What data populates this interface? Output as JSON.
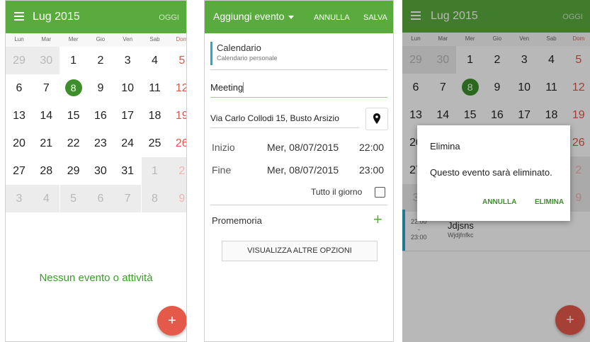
{
  "screen1": {
    "month_title": "Lug 2015",
    "today_button": "OGGI",
    "weekdays": [
      "Lun",
      "Mar",
      "Mer",
      "Gio",
      "Ven",
      "Sab",
      "Dom"
    ],
    "weeks": [
      [
        "29",
        "30",
        "1",
        "2",
        "3",
        "4",
        "5"
      ],
      [
        "6",
        "7",
        "8",
        "9",
        "10",
        "11",
        "12"
      ],
      [
        "13",
        "14",
        "15",
        "16",
        "17",
        "18",
        "19"
      ],
      [
        "20",
        "21",
        "22",
        "23",
        "24",
        "25",
        "26"
      ],
      [
        "27",
        "28",
        "29",
        "30",
        "31",
        "1",
        "2"
      ],
      [
        "3",
        "4",
        "5",
        "6",
        "7",
        "8",
        "9"
      ]
    ],
    "empty_message": "Nessun evento o attività",
    "fab_label": "+"
  },
  "screen2": {
    "header_title": "Aggiungi evento",
    "cancel_label": "ANNULLA",
    "save_label": "SALVA",
    "calendar_name": "Calendario",
    "calendar_sub": "Calendario personale",
    "title_value": "Meeting",
    "location_value": "Via Carlo Collodi 15, Busto Arsizio",
    "start_label": "Inizio",
    "start_date": "Mer, 08/07/2015",
    "start_time": "22:00",
    "end_label": "Fine",
    "end_date": "Mer, 08/07/2015",
    "end_time": "23:00",
    "all_day_label": "Tutto il giorno",
    "reminder_label": "Promemoria",
    "reminder_add": "+",
    "more_options_label": "VISUALIZZA ALTRE OPZIONI"
  },
  "screen3": {
    "month_title": "Lug 2015",
    "today_button": "OGGI",
    "event_time_start": "22:00",
    "event_time_sep": "-",
    "event_time_end": "23:00",
    "event_title": "Jdjsns",
    "event_location": "Wjdjfnfkc",
    "dialog_title": "Elimina",
    "dialog_message": "Questo evento sarà eliminato.",
    "dialog_cancel": "ANNULLA",
    "dialog_confirm": "ELIMINA",
    "fab_label": "+"
  },
  "colors": {
    "appbar": "#5aab3e",
    "today_circle": "#3d8f2c",
    "sunday": "#e0574b",
    "fab": "#e4594a",
    "calendar_accent": "#2ba7c8"
  }
}
